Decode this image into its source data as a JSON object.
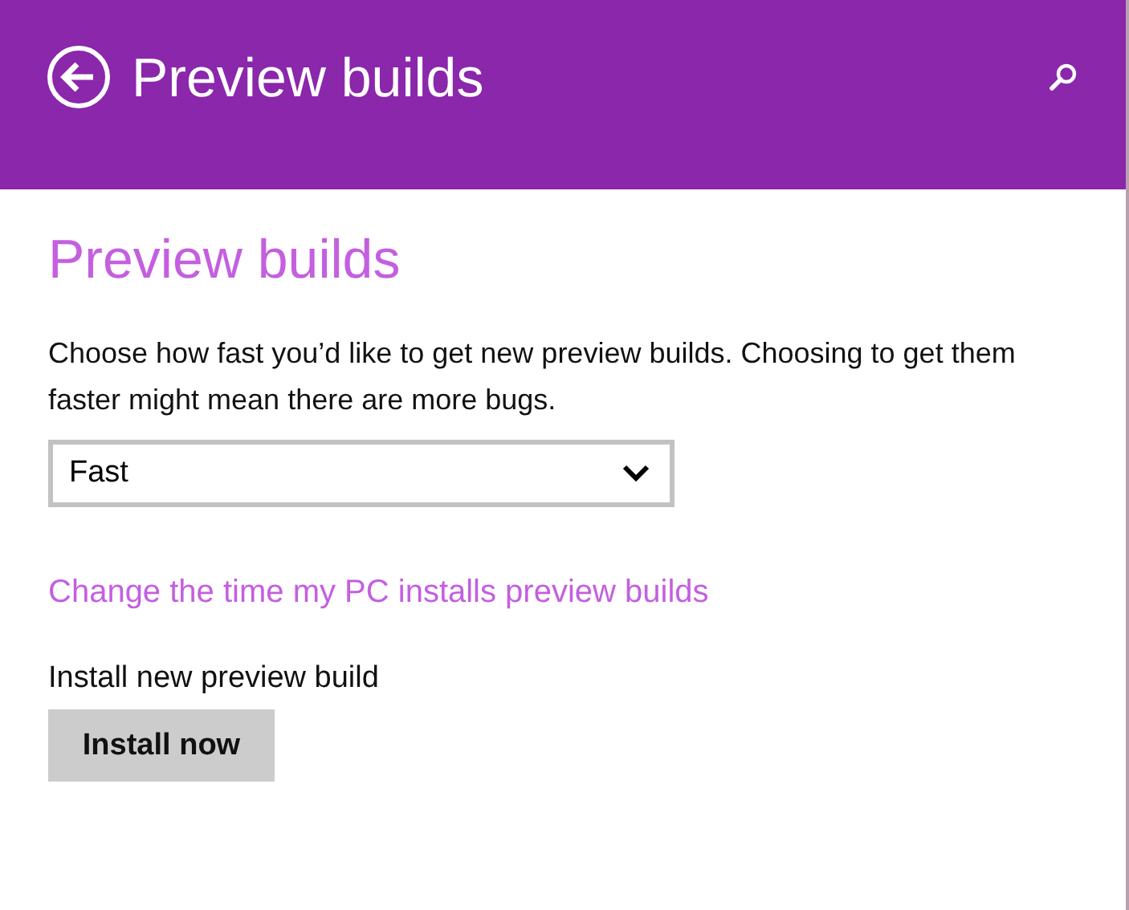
{
  "header": {
    "title": "Preview builds"
  },
  "section": {
    "heading": "Preview builds",
    "description": "Choose how fast you’d like to get new preview builds. Choosing to get them faster might mean there are more bugs.",
    "dropdown": {
      "value": "Fast"
    },
    "link": "Change the time my PC installs preview builds",
    "install_label": "Install new preview build",
    "button": "Install now"
  }
}
